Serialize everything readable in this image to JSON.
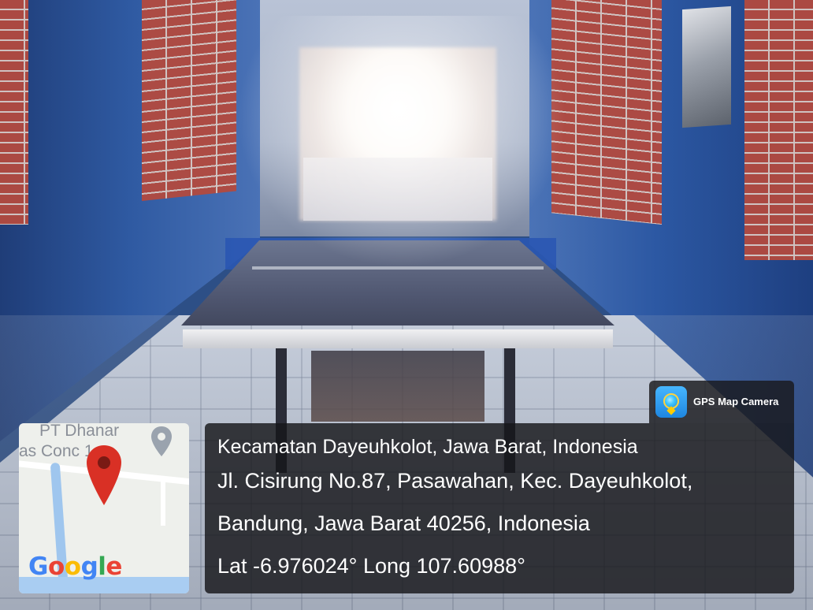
{
  "photo": {
    "subject_colors": {
      "wall": "#2f5aa2",
      "brick": "#b34a3f",
      "table": "#4f5670"
    }
  },
  "map": {
    "label_line_1": "PT Dhanar",
    "label_line_2": "as Conc    1",
    "logo": [
      "G",
      "o",
      "o",
      "g",
      "l",
      "e"
    ],
    "logo_colors": [
      "#4285F4",
      "#EA4335",
      "#FBBC05",
      "#4285F4",
      "#34A853",
      "#EA4335"
    ],
    "pin_color": "#d93025",
    "poi_icon": "location-marker-icon"
  },
  "app_badge": {
    "name": "GPS Map Camera",
    "icon": "gps-map-camera-icon"
  },
  "location": {
    "title": "Kecamatan Dayeuhkolot, Jawa Barat, Indonesia",
    "address_line_1": "Jl. Cisirung No.87, Pasawahan, Kec. Dayeuhkolot,",
    "address_line_2": "Bandung, Jawa Barat 40256, Indonesia",
    "coordinates": "Lat -6.976024° Long 107.60988°"
  }
}
